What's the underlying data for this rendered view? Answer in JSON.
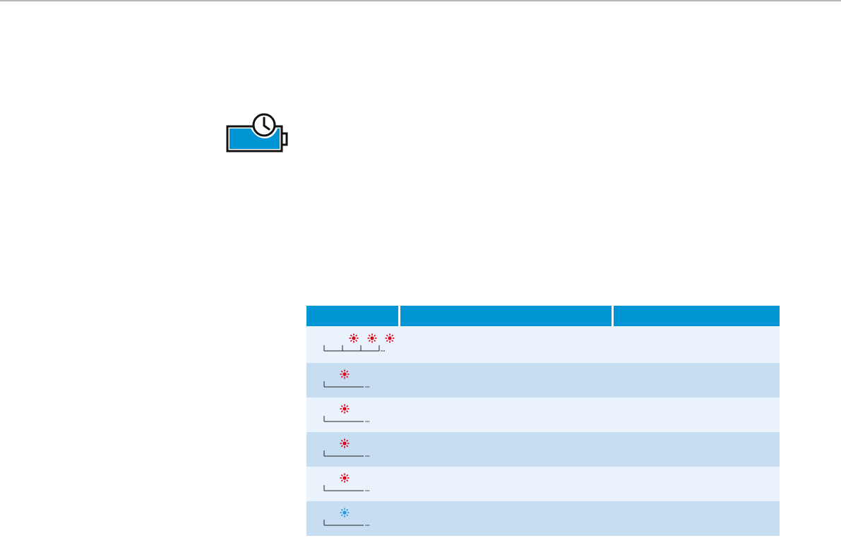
{
  "colors": {
    "accent": "#0096d6",
    "battery_fill": "#0096d6",
    "led_red": "#e2001a",
    "led_blue": "#1e9be0",
    "row_light": "#eaf3fb",
    "row_dark": "#c7ddf2",
    "rule": "#b7b7b7"
  },
  "icons": {
    "battery": "battery-charging-timer-icon"
  },
  "led_table": {
    "headers": [
      "",
      "",
      ""
    ],
    "rows": [
      {
        "pattern": "triple-blink",
        "led_color": "red",
        "cells": [
          "",
          ""
        ]
      },
      {
        "pattern": "single-blink",
        "led_color": "red",
        "cells": [
          "",
          ""
        ]
      },
      {
        "pattern": "single-blink",
        "led_color": "red",
        "cells": [
          "",
          ""
        ]
      },
      {
        "pattern": "single-blink",
        "led_color": "red",
        "cells": [
          "",
          ""
        ]
      },
      {
        "pattern": "single-blink",
        "led_color": "red",
        "cells": [
          "",
          ""
        ]
      },
      {
        "pattern": "single-blink",
        "led_color": "blue",
        "cells": [
          "",
          ""
        ]
      }
    ]
  }
}
